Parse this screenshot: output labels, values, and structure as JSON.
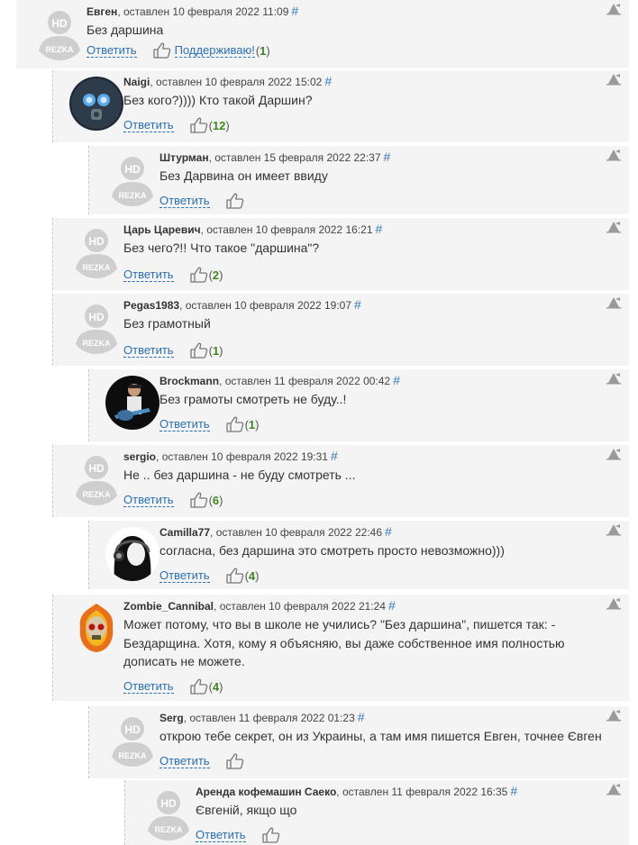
{
  "comments": [
    {
      "author": "Евген",
      "posted": "оставлен 10 февраля 2022 11:09",
      "anchor": "#",
      "text": "Без даршина",
      "reply_label": "Ответить",
      "support_label": "Поддерживаю!",
      "likes": "1",
      "avatar": "hd-rezka-default-icon"
    },
    {
      "author": "Naigi",
      "posted": "оставлен 10 февраля 2022 15:02",
      "anchor": "#",
      "text": "Без кого?)))) Кто такой Даршин?",
      "reply_label": "Ответить",
      "likes": "12",
      "avatar": "gas-mask-avatar"
    },
    {
      "author": "Штурман",
      "posted": "оставлен 15 февраля 2022 22:37",
      "anchor": "#",
      "text": "Без Дарвина он имеет ввиду",
      "reply_label": "Ответить",
      "likes": "",
      "avatar": "hd-rezka-default-icon"
    },
    {
      "author": "Царь Царевич",
      "posted": "оставлен 10 февраля 2022 16:21",
      "anchor": "#",
      "text": "Без чего?!! Что такое \"даршина\"?",
      "reply_label": "Ответить",
      "likes": "2",
      "avatar": "hd-rezka-default-icon"
    },
    {
      "author": "Pegas1983",
      "posted": "оставлен 10 февраля 2022 19:07",
      "anchor": "#",
      "text": "Без грамотный",
      "reply_label": "Ответить",
      "likes": "1",
      "avatar": "hd-rezka-default-icon"
    },
    {
      "author": "Brockmann",
      "posted": "оставлен 11 февраля 2022 00:42",
      "anchor": "#",
      "text": "Без грамоты смотреть не буду..!",
      "reply_label": "Ответить",
      "likes": "1",
      "avatar": "guitarist-avatar"
    },
    {
      "author": "sergio",
      "posted": "оставлен 10 февраля 2022 19:31",
      "anchor": "#",
      "text": "Не .. без даршина - не буду смотреть ...",
      "reply_label": "Ответить",
      "likes": "6",
      "avatar": "hd-rezka-default-icon"
    },
    {
      "author": "Camilla77",
      "posted": "оставлен 10 февраля 2022 22:46",
      "anchor": "#",
      "text": "согласна, без даршина это смотреть просто невозможно)))",
      "reply_label": "Ответить",
      "likes": "4",
      "avatar": "headphones-girl-avatar"
    },
    {
      "author": "Zombie_Cannibal",
      "posted": "оставлен 10 февраля 2022 21:24",
      "anchor": "#",
      "text": "Может потому, что вы в школе не учились? \"Без даршина\", пишется так: - Бездарщина. Хотя, кому я объясняю, вы даже собственное имя полностью дописать не можете.",
      "reply_label": "Ответить",
      "likes": "4",
      "avatar": "flaming-skull-avatar"
    },
    {
      "author": "Serg",
      "posted": "оставлен 11 февраля 2022 01:23",
      "anchor": "#",
      "text": "открою тебе секрет, он из Украины, а там имя пишется Евген, точнее Євген",
      "reply_label": "Ответить",
      "likes": "",
      "avatar": "hd-rezka-default-icon"
    },
    {
      "author": "Аренда кофемашин Саеко",
      "posted": "оставлен 11 февраля 2022 16:35",
      "anchor": "#",
      "text": "Євгеній, якщо що",
      "reply_label": "Ответить",
      "likes": "",
      "avatar": "hd-rezka-default-icon"
    }
  ],
  "avatar_text": {
    "hd": "HD",
    "rezka": "REZKA"
  },
  "colors": {
    "link": "#2a6fb2",
    "like_count": "#3b8a1d",
    "panel": "#f4f4f4",
    "default_avatar": "#cfcfcf"
  }
}
